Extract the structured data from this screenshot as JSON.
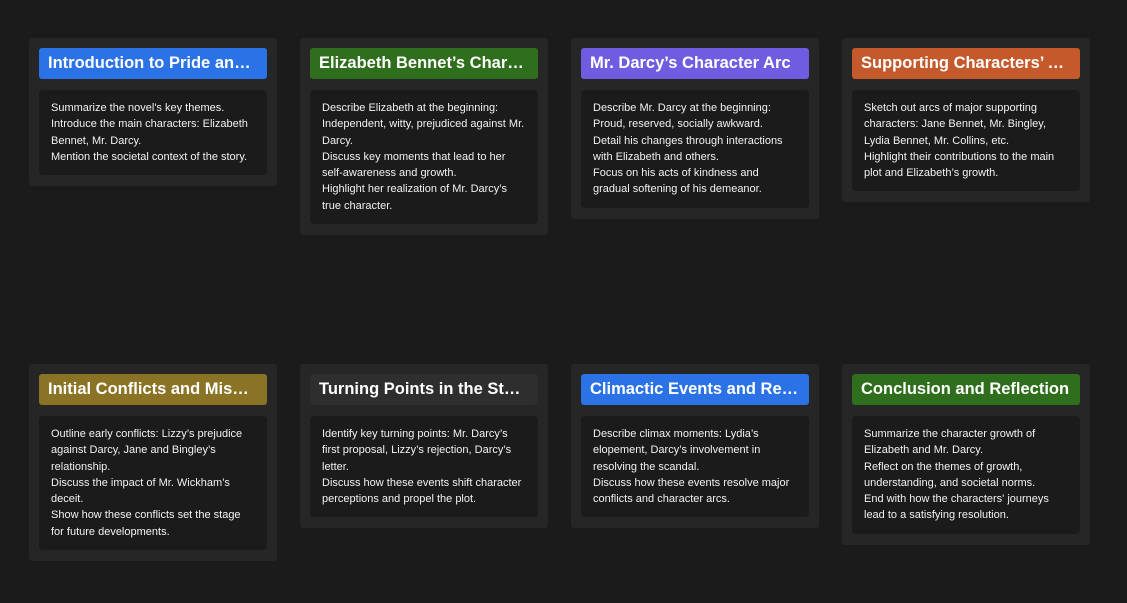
{
  "cards": [
    {
      "title": "Introduction to Pride and Prejudice",
      "color": "#2a72e5",
      "lines": [
        "Summarize the novel's key themes.",
        "Introduce the main characters: Elizabeth Bennet, Mr. Darcy.",
        "Mention the societal context of the story."
      ]
    },
    {
      "title": "Elizabeth Bennet’s Character Arc",
      "color": "#2f6e1c",
      "lines": [
        "Describe Elizabeth at the beginning: Independent, witty, prejudiced against Mr. Darcy.",
        "Discuss key moments that lead to her self-awareness and growth.",
        "Highlight her realization of Mr. Darcy’s true character."
      ]
    },
    {
      "title": "Mr. Darcy’s Character Arc",
      "color": "#6f5ce0",
      "lines": [
        "Describe Mr. Darcy at the beginning: Proud, reserved, socially awkward.",
        "Detail his changes through interactions with Elizabeth and others.",
        "Focus on his acts of kindness and gradual softening of his demeanor."
      ]
    },
    {
      "title": "Supporting Characters’ Arcs",
      "color": "#c45a2c",
      "lines": [
        "Sketch out arcs of major supporting characters: Jane Bennet, Mr. Bingley, Lydia Bennet, Mr. Collins, etc.",
        "Highlight their contributions to the main plot and Elizabeth’s growth."
      ]
    },
    {
      "title": "Initial Conflicts and Misunderstandings",
      "color": "#8a7325",
      "lines": [
        "Outline early conflicts: Lizzy’s prejudice against Darcy, Jane and Bingley’s relationship.",
        "Discuss the impact of Mr. Wickham’s deceit.",
        "Show how these conflicts set the stage for future developments."
      ]
    },
    {
      "title": "Turning Points in the Story",
      "color": "#2e2e2e",
      "lines": [
        "Identify key turning points: Mr. Darcy’s first proposal, Lizzy’s rejection, Darcy’s letter.",
        "Discuss how these events shift character perceptions and propel the plot."
      ]
    },
    {
      "title": "Climactic Events and Resolution",
      "color": "#2a72e5",
      "lines": [
        "Describe climax moments: Lydia’s elopement, Darcy’s involvement in resolving the scandal.",
        "Discuss how these events resolve major conflicts and character arcs."
      ]
    },
    {
      "title": "Conclusion and Reflection",
      "color": "#2f6e1c",
      "lines": [
        "Summarize the character growth of Elizabeth and Mr. Darcy.",
        "Reflect on the themes of growth, understanding, and societal norms.",
        "End with how the characters' journeys lead to a satisfying resolution."
      ]
    }
  ]
}
